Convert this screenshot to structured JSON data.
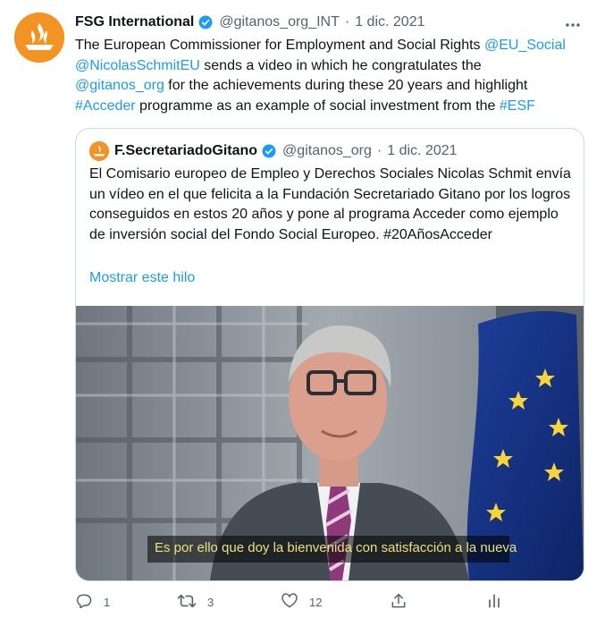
{
  "tweet": {
    "author_name": "FSG International",
    "author_handle": "@gitanos_org_INT",
    "separator": "·",
    "date": "1 dic. 2021",
    "text_1": "The European Commissioner for Employment and Social Rights ",
    "mention_1": "@EU_Social",
    "mention_2": "@NicolasSchmitEU",
    "text_2": " sends a video in which he congratulates the ",
    "mention_3": "@gitanos_org",
    "text_3": " for the achievements during these 20 years and highlight ",
    "hashtag_1": "#Acceder",
    "text_4": " programme as an example of social investment from the ",
    "hashtag_2": "#ESF"
  },
  "quote": {
    "author_name": "F.SecretariadoGitano",
    "author_handle": "@gitanos_org",
    "separator": "·",
    "date": "1 dic. 2021",
    "text": "El Comisario europeo de Empleo y Derechos Sociales Nicolas Schmit envía un vídeo en el que felicita a la Fundación Secretariado Gitano por los logros conseguidos en estos 20 años y pone al programa Acceder como ejemplo de inversión social del Fondo Social Europeo. #20AñosAcceder",
    "show_thread": "Mostrar este hilo",
    "video_caption": "Es por ello que doy la bienvenida con satisfacción a la nueva"
  },
  "actions": {
    "reply_count": "1",
    "retweet_count": "3",
    "like_count": "12",
    "share_icon": "share-icon",
    "analytics_icon": "analytics-icon"
  },
  "colors": {
    "link": "#1d9bf0",
    "secondary_text": "#536471",
    "verified": "#1d9bf0",
    "avatar_orange": "#f39324"
  }
}
